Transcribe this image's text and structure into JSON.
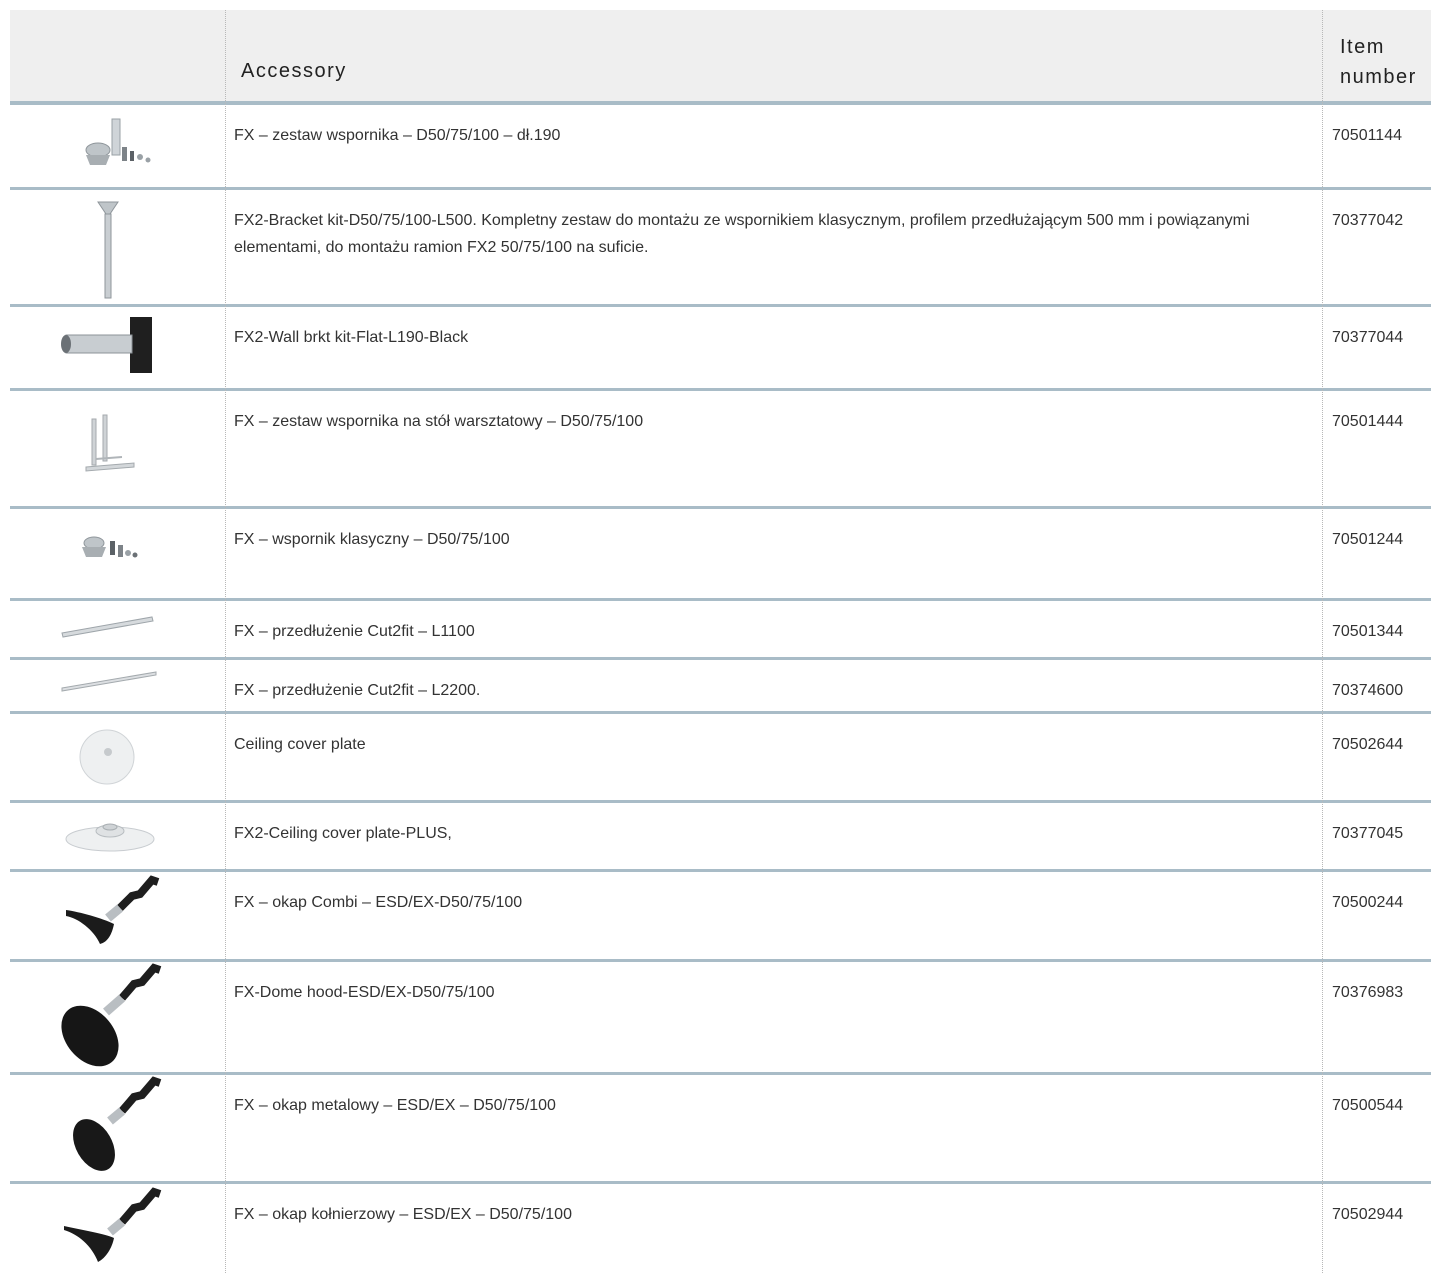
{
  "header": {
    "accessory_label": "Accessory",
    "item_label_line1": "Item",
    "item_label_line2": "number"
  },
  "rows": [
    {
      "desc": "FX – zestaw wspornika – D50/75/100 – dł.190",
      "num": "70501144",
      "icon": "bracket-kit-icon"
    },
    {
      "desc": "FX2-Bracket kit-D50/75/100-L500. Kompletny zestaw do montażu ze wspornikiem klasycznym, profilem przedłużającym 500 mm i powiązanymi elementami, do montażu ramion FX2 50/75/100 na suficie.",
      "num": "70377042",
      "icon": "bracket-pole-icon"
    },
    {
      "desc": "FX2-Wall brkt kit-Flat-L190-Black",
      "num": "70377044",
      "icon": "wall-bracket-icon"
    },
    {
      "desc": "FX – zestaw wspornika na stół warsztatowy – D50/75/100",
      "num": "70501444",
      "icon": "bench-bracket-icon"
    },
    {
      "desc": "FX – wspornik klasyczny – D50/75/100",
      "num": "70501244",
      "icon": "classic-bracket-icon"
    },
    {
      "desc": "FX – przedłużenie Cut2fit – L1100",
      "num": "70501344",
      "icon": "extension-tube-icon"
    },
    {
      "desc": "FX – przedłużenie Cut2fit – L2200.",
      "num": "70374600",
      "icon": "extension-tube-long-icon"
    },
    {
      "desc": "Ceiling cover plate",
      "num": "70502644",
      "icon": "cover-plate-icon"
    },
    {
      "desc": "FX2-Ceiling cover plate-PLUS,",
      "num": "70377045",
      "icon": "cover-plate-plus-icon"
    },
    {
      "desc": "FX – okap Combi – ESD/EX-D50/75/100",
      "num": "70500244",
      "icon": "combi-hood-icon"
    },
    {
      "desc": "FX-Dome hood-ESD/EX-D50/75/100",
      "num": "70376983",
      "icon": "dome-hood-icon"
    },
    {
      "desc": "FX – okap metalowy – ESD/EX – D50/75/100",
      "num": "70500544",
      "icon": "metal-hood-icon"
    },
    {
      "desc": "FX – okap kołnierzowy – ESD/EX – D50/75/100",
      "num": "70502944",
      "icon": "flange-hood-icon"
    }
  ],
  "colors": {
    "row_border": "#a9bcc7",
    "header_bg": "#efefef"
  }
}
